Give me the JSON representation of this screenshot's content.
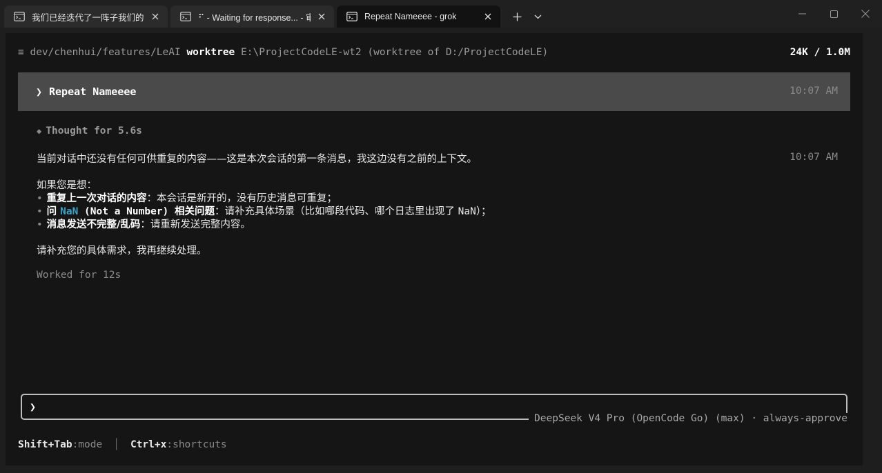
{
  "window": {
    "tabs": [
      {
        "title": "我们已经迭代了一阵子我们的 L",
        "icon": "terminal-icon",
        "active": false
      },
      {
        "title": "⠋ - Waiting for response... - 审",
        "icon": "terminal-icon",
        "active": false
      },
      {
        "title": "Repeat Nameeee - grok",
        "icon": "terminal-icon",
        "active": true
      }
    ],
    "new_tab_icon": "plus-icon",
    "dropdown_icon": "chevron-down-icon",
    "controls": [
      "minimize-icon",
      "maximize-icon",
      "close-icon"
    ]
  },
  "status": {
    "menu_glyph": "≡",
    "branch_path": "dev/chenhui/features/LeAI",
    "worktree_label": "worktree",
    "worktree_info": "E:\\ProjectCodeLE-wt2 (worktree of D:/ProjectCodeLE)",
    "tokens": "24K / 1.0M"
  },
  "conversation": {
    "user_prompt_glyph": "❯",
    "user_message": "Repeat Nameeee",
    "user_time": "10:07 AM",
    "thought_glyph": "◆",
    "thought": "Thought for 5.6s",
    "response_time": "10:07 AM",
    "response": {
      "intro": "当前对话中还没有任何可供重复的内容——这是本次会话的第一条消息，我这边没有之前的上下文。",
      "if_heading": "如果您是想：",
      "bullet_glyph": "•",
      "bullets": [
        {
          "bold": "重复上一次对话的内容",
          "rest": "：本会话是新开的，没有历史消息可重复；"
        },
        {
          "bold_prefix": "问 ",
          "code": "NaN",
          "bold_suffix": " (Not a Number) 相关问题",
          "rest_a": "：请补充具体场景（比如哪段代码、哪个日志里出现了 ",
          "rest_code": "NaN",
          "rest_b": "）；"
        },
        {
          "bold": "消息发送不完整/乱码",
          "rest": "：请重新发送完整内容。"
        }
      ],
      "closing": "请补充您的具体需求，我再继续处理。"
    },
    "worked": "Worked for 12s"
  },
  "input": {
    "prompt_glyph": "❯",
    "value": "",
    "model_label": "DeepSeek V4 Pro (OpenCode Go) (max) · always-approve"
  },
  "footer": {
    "shortcut1_key": "Shift+Tab",
    "shortcut1_desc": ":mode",
    "separator": "│",
    "shortcut2_key": "Ctrl+x",
    "shortcut2_desc": ":shortcuts"
  }
}
